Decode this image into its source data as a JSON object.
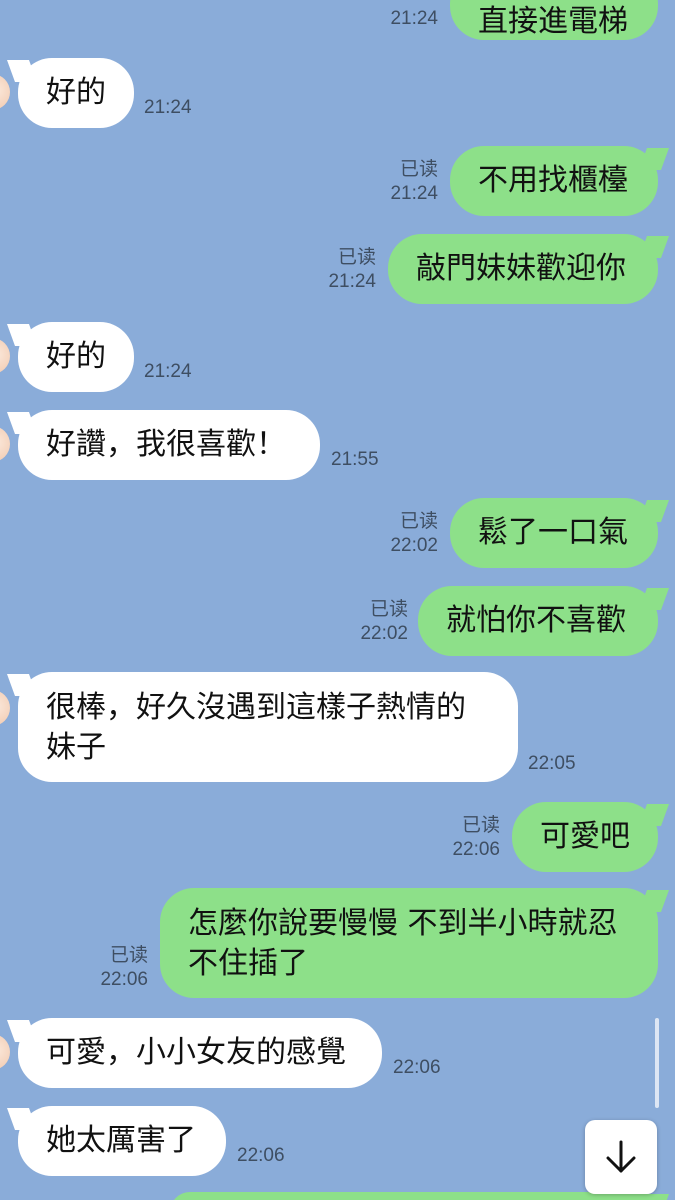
{
  "messages": [
    {
      "side": "out",
      "text": "直接進電梯",
      "read": "",
      "time": "21:24"
    },
    {
      "side": "in",
      "text": "好的",
      "time": "21:24"
    },
    {
      "side": "out",
      "text": "不用找櫃檯",
      "read": "已读",
      "time": "21:24"
    },
    {
      "side": "out",
      "text": "敲門妹妹歡迎你",
      "read": "已读",
      "time": "21:24"
    },
    {
      "side": "in",
      "text": "好的",
      "time": "21:24"
    },
    {
      "side": "in",
      "text": "好讚，我很喜歡！",
      "time": "21:55"
    },
    {
      "side": "out",
      "text": "鬆了一口氣",
      "read": "已读",
      "time": "22:02"
    },
    {
      "side": "out",
      "text": "就怕你不喜歡",
      "read": "已读",
      "time": "22:02"
    },
    {
      "side": "in",
      "lines": [
        "很棒，好久沒遇到這樣子熱情的",
        "妹子"
      ],
      "time": "22:05"
    },
    {
      "side": "out",
      "text": "可愛吧",
      "read": "已读",
      "time": "22:06"
    },
    {
      "side": "out",
      "lines": [
        "怎麼你說要慢慢 不到半小時就忍",
        "不住插了"
      ],
      "read": "已读",
      "time": "22:06"
    },
    {
      "side": "in",
      "text": "可愛，小小女友的感覺",
      "time": "22:06"
    },
    {
      "side": "in",
      "text": "她太厲害了",
      "time": "22:06"
    }
  ],
  "colors": {
    "background": "#8aacd9",
    "incoming_bubble": "#ffffff",
    "outgoing_bubble": "#8de089",
    "meta_text": "#3e4e62"
  },
  "icons": {
    "scroll_down": "arrow-down-icon",
    "avatar": "contact-avatar"
  }
}
